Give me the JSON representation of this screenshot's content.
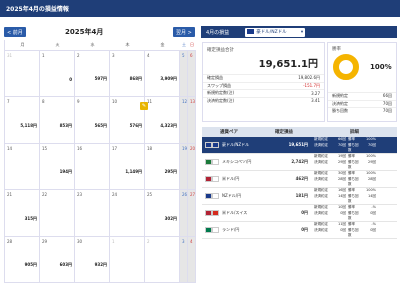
{
  "header": {
    "title": "2025年4月の損益情報"
  },
  "calendar": {
    "prev_label": "< 前月",
    "month_label": "2025年4月",
    "next_label": "翌月 >",
    "weekdays": [
      "月",
      "火",
      "水",
      "木",
      "金",
      "土",
      "日"
    ],
    "weeks": [
      [
        {
          "d": "31",
          "g": true,
          "p": ""
        },
        {
          "d": "1",
          "p": "0"
        },
        {
          "d": "2",
          "p": "597円"
        },
        {
          "d": "3",
          "p": "868円"
        },
        {
          "d": "4",
          "p": "3,909円"
        },
        {
          "d": "5",
          "p": ""
        },
        {
          "d": "6",
          "p": ""
        }
      ],
      [
        {
          "d": "7",
          "p": "5,118円"
        },
        {
          "d": "8",
          "p": "853円"
        },
        {
          "d": "9",
          "p": "565円"
        },
        {
          "d": "10",
          "p": "576円"
        },
        {
          "d": "11",
          "p": "4,323円"
        },
        {
          "d": "12",
          "p": ""
        },
        {
          "d": "13",
          "p": ""
        }
      ],
      [
        {
          "d": "14",
          "p": ""
        },
        {
          "d": "15",
          "p": "194円"
        },
        {
          "d": "16",
          "p": ""
        },
        {
          "d": "17",
          "p": "1,149円"
        },
        {
          "d": "18",
          "p": "295円"
        },
        {
          "d": "19",
          "p": ""
        },
        {
          "d": "20",
          "p": ""
        }
      ],
      [
        {
          "d": "21",
          "p": "315円"
        },
        {
          "d": "22",
          "p": ""
        },
        {
          "d": "23",
          "p": ""
        },
        {
          "d": "24",
          "p": ""
        },
        {
          "d": "25",
          "p": "302円"
        },
        {
          "d": "26",
          "p": ""
        },
        {
          "d": "27",
          "p": ""
        }
      ],
      [
        {
          "d": "28",
          "p": "905円"
        },
        {
          "d": "29",
          "p": "603円"
        },
        {
          "d": "30",
          "p": "932円"
        },
        {
          "d": "1",
          "g": true,
          "p": ""
        },
        {
          "d": "2",
          "g": true,
          "p": ""
        },
        {
          "d": "3",
          "g": true,
          "p": ""
        },
        {
          "d": "4",
          "g": true,
          "p": ""
        }
      ]
    ]
  },
  "panel": {
    "title": "4月の損益",
    "pair_select": "豪ドル/NZドル",
    "total_label": "確定損益合計",
    "total_value": "19,651.1円",
    "stats": [
      {
        "k": "確定損益",
        "v": "19,802.6円",
        "neg": false
      },
      {
        "k": "スワップ損益",
        "v": "-151.7円",
        "neg": true
      },
      {
        "k": "新規約定数(注)",
        "v": "3.27",
        "neg": false
      },
      {
        "k": "決済約定数(注)",
        "v": "3.41",
        "neg": false
      }
    ],
    "win_label": "勝率",
    "win_value": "100%",
    "win_fraction": 1.0,
    "win_stats": [
      {
        "k": "新規約定",
        "v": "66回"
      },
      {
        "k": "決済約定",
        "v": "70回"
      },
      {
        "k": "勝ち回数",
        "v": "70回"
      }
    ],
    "table_headers": [
      "通貨ペア",
      "確定損益",
      "詳細"
    ],
    "pairs": [
      {
        "name": "豪ドル/NZドル",
        "pnl": "19,651円",
        "d": [
          "新規約定",
          "66回",
          "勝率",
          "100%",
          "決済約定",
          "70回",
          "勝ち回数",
          "70回"
        ],
        "hl": true,
        "colors": [
          "#1a3a8a",
          "#1a3a8a"
        ]
      },
      {
        "name": "メキシコペソ/円",
        "pnl": "2,742円",
        "d": [
          "新規約定",
          "19回",
          "勝率",
          "100%",
          "決済約定",
          "29回",
          "勝ち回数",
          "29回"
        ],
        "colors": [
          "#1a7a3a",
          "#ffffff"
        ]
      },
      {
        "name": "米ドル/円",
        "pnl": "462円",
        "d": [
          "新規約定",
          "30回",
          "勝率",
          "100%",
          "決済約定",
          "28回",
          "勝ち回数",
          "28回"
        ],
        "colors": [
          "#b22234",
          "#ffffff"
        ]
      },
      {
        "name": "NZドル/円",
        "pnl": "181円",
        "d": [
          "新規約定",
          "16回",
          "勝率",
          "100%",
          "決済約定",
          "14回",
          "勝ち回数",
          "14回"
        ],
        "colors": [
          "#1a3a8a",
          "#ffffff"
        ]
      },
      {
        "name": "米ドル/スイス",
        "pnl": "0円",
        "d": [
          "新規約定",
          "10回",
          "勝率",
          "-%",
          "決済約定",
          "0回",
          "勝ち回数",
          "0回"
        ],
        "colors": [
          "#b22234",
          "#d52b1e"
        ]
      },
      {
        "name": "ランド/円",
        "pnl": "0円",
        "d": [
          "新規約定",
          "11回",
          "勝率",
          "-%",
          "決済約定",
          "0回",
          "勝ち回数",
          "0回"
        ],
        "colors": [
          "#007a4d",
          "#ffffff"
        ]
      }
    ]
  }
}
